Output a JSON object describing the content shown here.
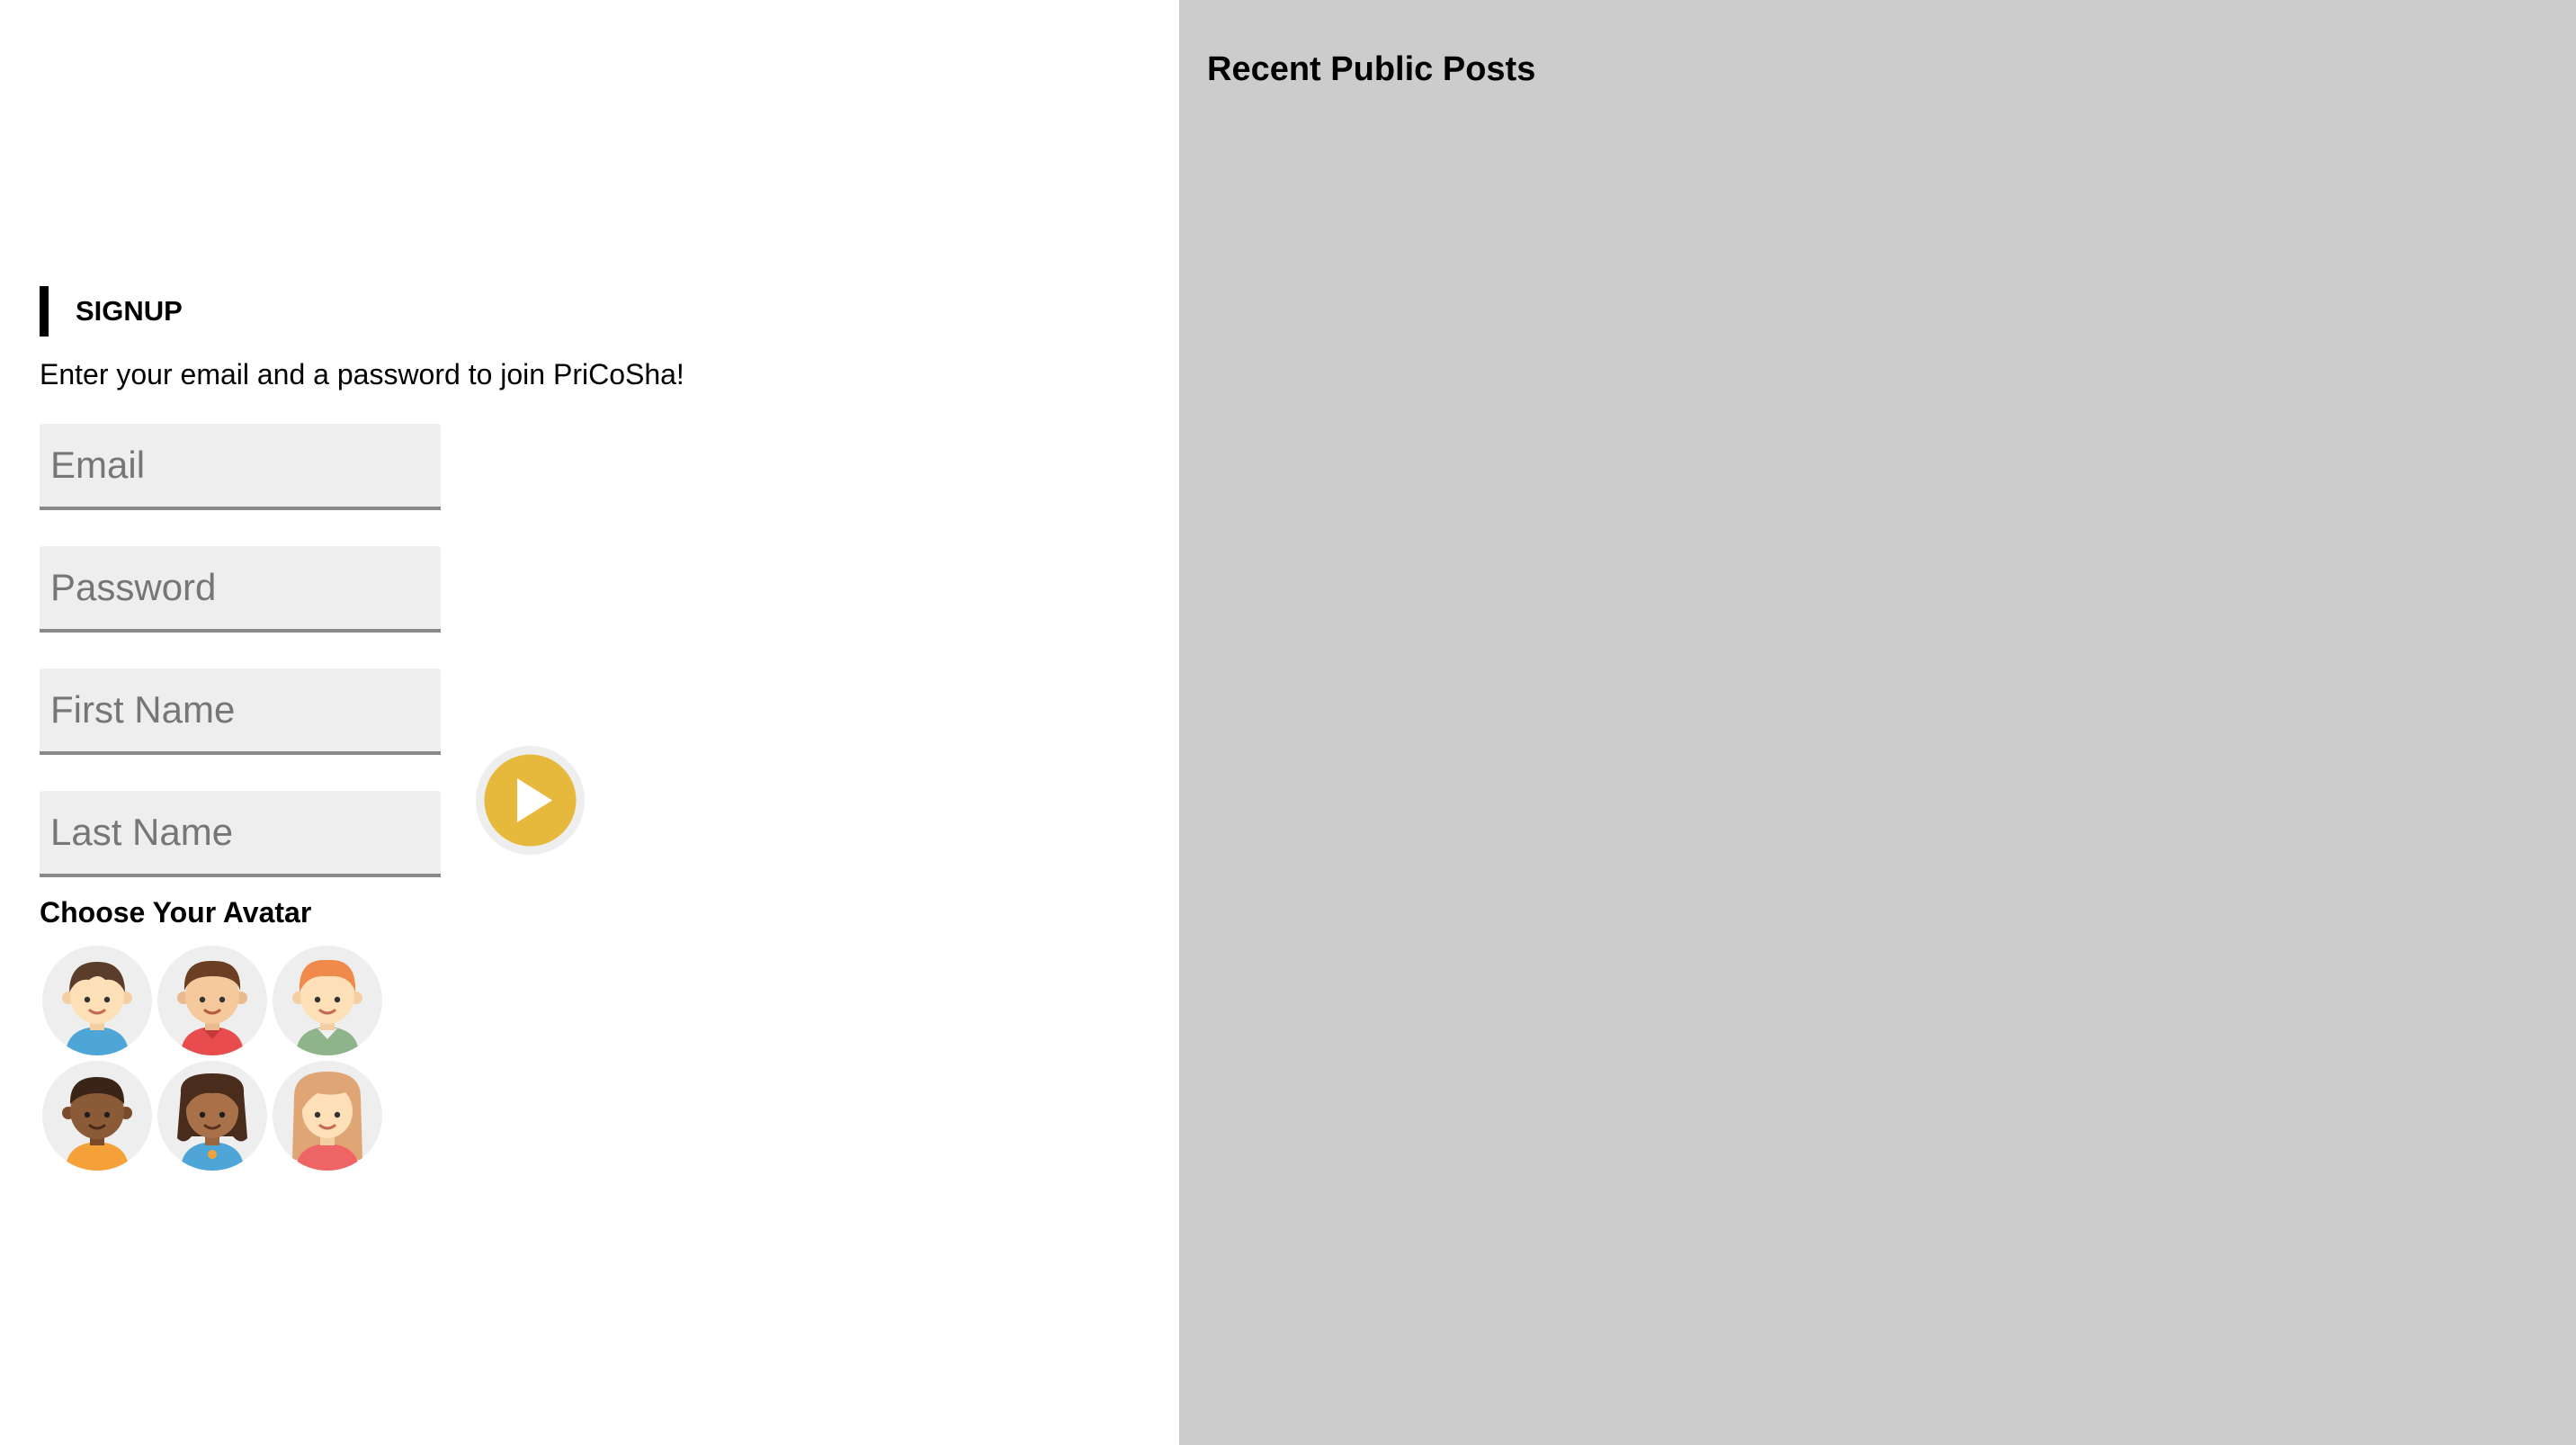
{
  "signup": {
    "heading": "SIGNUP",
    "description": "Enter your email and a password to join PriCoSha!",
    "fields": {
      "email_placeholder": "Email",
      "password_placeholder": "Password",
      "first_name_placeholder": "First Name",
      "last_name_placeholder": "Last Name"
    },
    "submit_icon": "play-icon",
    "avatar_label": "Choose Your Avatar",
    "avatars": [
      {
        "icon": "boy-avatar-icon",
        "shirt_color": "#4da6d6"
      },
      {
        "icon": "boy-avatar-icon",
        "shirt_color": "#e84c4c"
      },
      {
        "icon": "ginger-boy-avatar-icon",
        "shirt_color": "#8fb38a"
      },
      {
        "icon": "dark-skin-boy-avatar-icon",
        "shirt_color": "#f5a13a"
      },
      {
        "icon": "dark-skin-girl-avatar-icon",
        "shirt_color": "#4da6d6"
      },
      {
        "icon": "girl-avatar-icon",
        "shirt_color": "#ef6464"
      }
    ]
  },
  "posts": {
    "title": "Recent Public Posts"
  },
  "colors": {
    "accent": "#e6b93c",
    "panel_background": "#cccccc",
    "field_background": "#eeeeee",
    "field_underline": "#888888"
  }
}
